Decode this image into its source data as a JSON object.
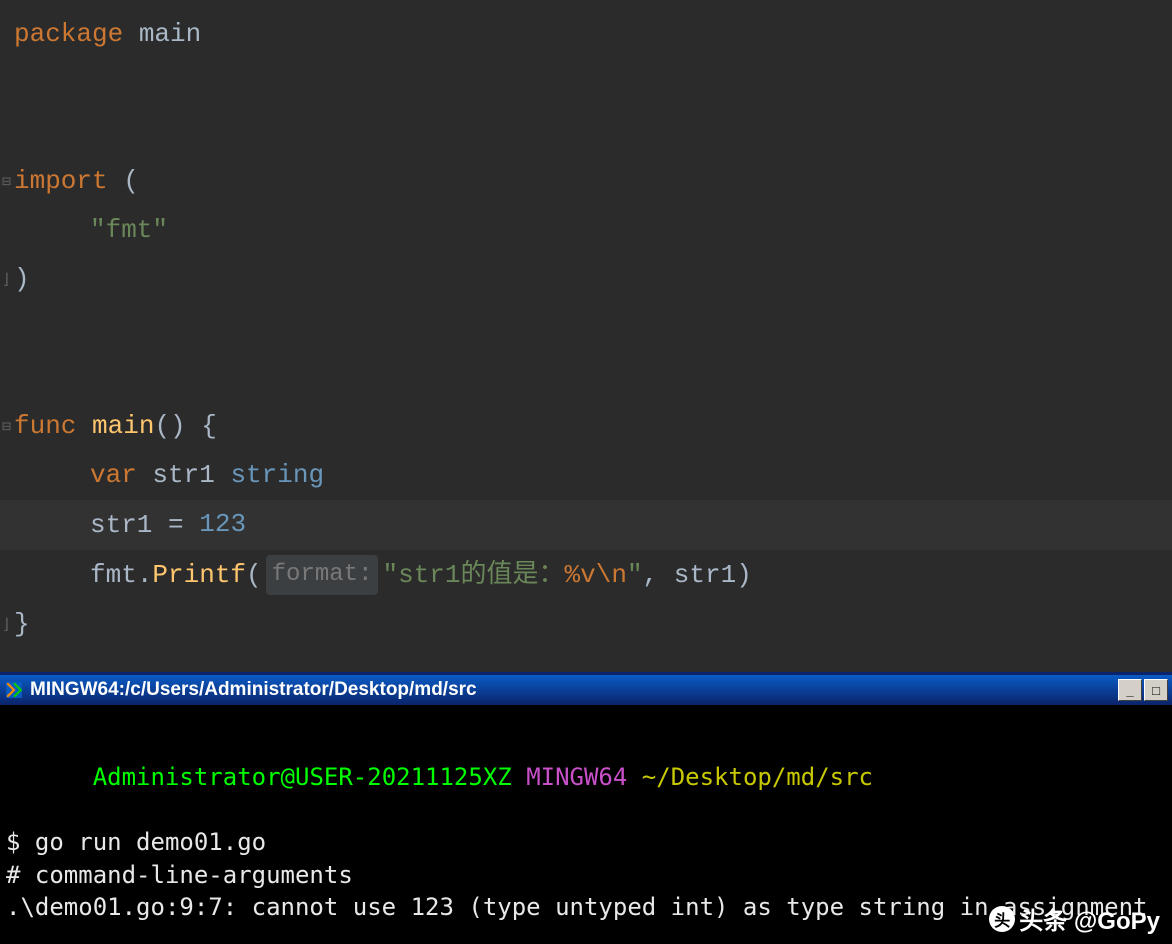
{
  "code": {
    "line1": {
      "package": "package",
      "name": "main"
    },
    "line2": {
      "import": "import",
      "paren_open": "("
    },
    "line3": {
      "fmt": "\"fmt\""
    },
    "line4": {
      "paren_close": ")"
    },
    "line5": {
      "func": "func",
      "name": "main",
      "parens": "()",
      "brace": " {"
    },
    "line6": {
      "var": "var",
      "ident": "str1",
      "type": "string"
    },
    "line7": {
      "ident": "str1",
      "eq": " = ",
      "value": "123"
    },
    "line8": {
      "pkg": "fmt",
      "dot": ".",
      "fn": "Printf",
      "open": "(",
      "hint": "format:",
      "str_pre": "\"str1的值是：",
      "verb": "%v",
      "esc": "\\n",
      "str_post": "\"",
      "comma": ", ",
      "arg": "str1",
      "close": ")"
    },
    "line9": {
      "brace": "}"
    }
  },
  "terminal": {
    "title": "MINGW64:/c/Users/Administrator/Desktop/md/src",
    "prompt": {
      "user": "Administrator@USER-20211125XZ",
      "sep": " ",
      "env": "MINGW64",
      "path": "~/Desktop/md/src"
    },
    "lines": [
      "$ go run demo01.go",
      "# command-line-arguments",
      ".\\demo01.go:9:7: cannot use 123 (type untyped int) as type string in assignment"
    ]
  },
  "watermark": "头条 @GoPy"
}
